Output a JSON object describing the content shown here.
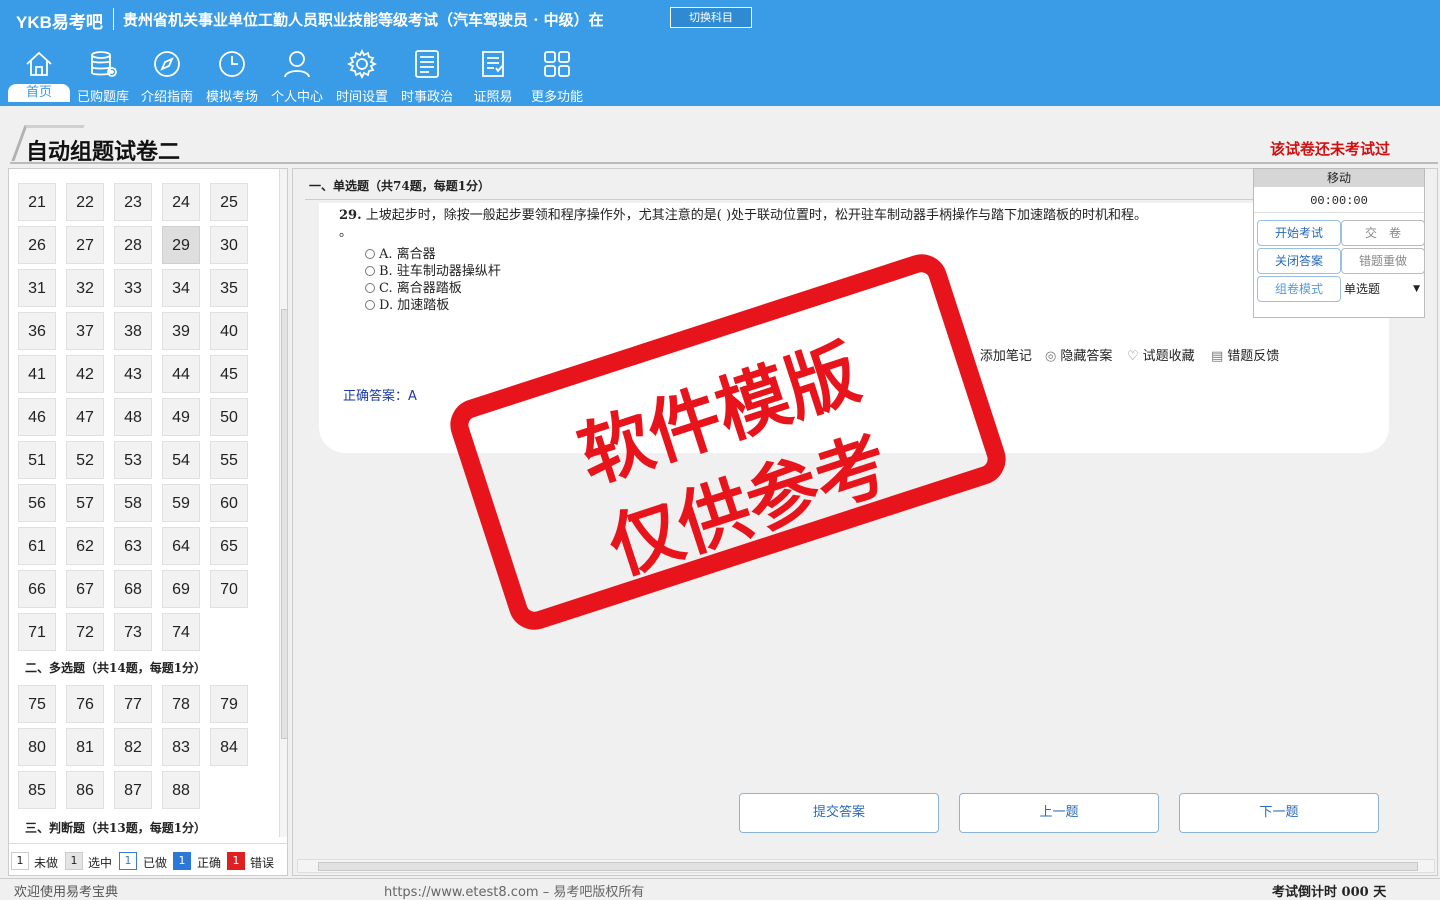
{
  "header": {
    "brand": "YKB易考吧",
    "exam_title": "贵州省机关事业单位工勤人员职业技能等级考试（汽车驾驶员 · 中级）在",
    "switch_label": "切换科目"
  },
  "nav": [
    {
      "label": "首页",
      "icon": "home-icon"
    },
    {
      "label": "已购题库",
      "icon": "database-icon"
    },
    {
      "label": "介绍指南",
      "icon": "compass-icon"
    },
    {
      "label": "模拟考场",
      "icon": "clock-icon"
    },
    {
      "label": "个人中心",
      "icon": "user-icon"
    },
    {
      "label": "时间设置",
      "icon": "gear-icon"
    },
    {
      "label": "时事政治",
      "icon": "news-icon"
    },
    {
      "label": "证照易",
      "icon": "certificate-icon"
    },
    {
      "label": "更多功能",
      "icon": "grid-icon"
    }
  ],
  "paper": {
    "title": "自动组题试卷二",
    "status": "该试卷还未考试过"
  },
  "left": {
    "single_numbers": [
      "21",
      "22",
      "23",
      "24",
      "25",
      "26",
      "27",
      "28",
      "29",
      "30",
      "31",
      "32",
      "33",
      "34",
      "35",
      "36",
      "37",
      "38",
      "39",
      "40",
      "41",
      "42",
      "43",
      "44",
      "45",
      "46",
      "47",
      "48",
      "49",
      "50",
      "51",
      "52",
      "53",
      "54",
      "55",
      "56",
      "57",
      "58",
      "59",
      "60",
      "61",
      "62",
      "63",
      "64",
      "65",
      "66",
      "67",
      "68",
      "69",
      "70",
      "71",
      "72",
      "73",
      "74"
    ],
    "current": "29",
    "section2": "二、多选题（共14题，每题1分）",
    "multi_numbers": [
      "75",
      "76",
      "77",
      "78",
      "79",
      "80",
      "81",
      "82",
      "83",
      "84",
      "85",
      "86",
      "87",
      "88"
    ],
    "section3": "三、判断题（共13题，每题1分）",
    "legend": [
      {
        "count": "1",
        "label": "未做"
      },
      {
        "count": "1",
        "label": "选中"
      },
      {
        "count": "1",
        "label": "已做"
      },
      {
        "count": "1",
        "label": "正确"
      },
      {
        "count": "1",
        "label": "错误"
      }
    ]
  },
  "question": {
    "section_head": "一、单选题（共74题，每题1分）",
    "number": "29.",
    "text": "上坡起步时，除按一般起步要领和程序操作外，尤其注意的是( )处于联动位置时，松开驻车制动器手柄操作与踏下加速踏板的时机和程。",
    "text_tail": "。",
    "options": [
      "A. 离合器",
      "B. 驻车制动器操纵杆",
      "C. 离合器踏板",
      "D. 加速踏板"
    ],
    "tools": [
      "添加笔记",
      "隐藏答案",
      "试题收藏",
      "错题反馈"
    ],
    "answer_label": "正确答案：",
    "answer_value": "A"
  },
  "right_panel": {
    "move_label": "移动",
    "timer": "00:00:00",
    "start": "开始考试",
    "submit_paper": "交　卷",
    "close_answer": "关闭答案",
    "redo_wrong": "错题重做",
    "compose_mode": "组卷模式",
    "mode_value": "单选题"
  },
  "bottom": {
    "submit": "提交答案",
    "prev": "上一题",
    "next": "下一题"
  },
  "statusbar": {
    "welcome": "欢迎使用易考宝典",
    "copyright": "https://www.etest8.com – 易考吧版权所有",
    "countdown": "考试倒计时 000 天"
  },
  "stamp": {
    "line1": "软件模版",
    "line2": "仅供参考",
    "color": "#e8141c"
  },
  "colors": {
    "header_bg": "#3a9be6",
    "status_red": "#d01010",
    "answer_blue": "#1a3aa8"
  }
}
